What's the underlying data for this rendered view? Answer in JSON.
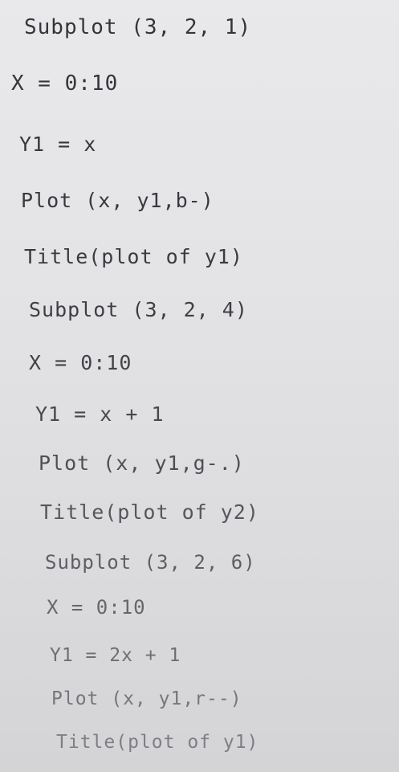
{
  "document": {
    "lines": [
      "Subplot (3, 2, 1)",
      "X = 0:10",
      "Y1 = x",
      "Plot (x, y1,b-)",
      "Title(plot of y1)",
      "Subplot (3, 2, 4)",
      "X = 0:10",
      "Y1 = x + 1",
      "Plot (x, y1,g-.)",
      "Title(plot of y2)",
      "Subplot (3, 2, 6)",
      "X = 0:10",
      "Y1 = 2x + 1",
      "Plot (x, y1,r--)",
      "Title(plot of y1)"
    ]
  }
}
